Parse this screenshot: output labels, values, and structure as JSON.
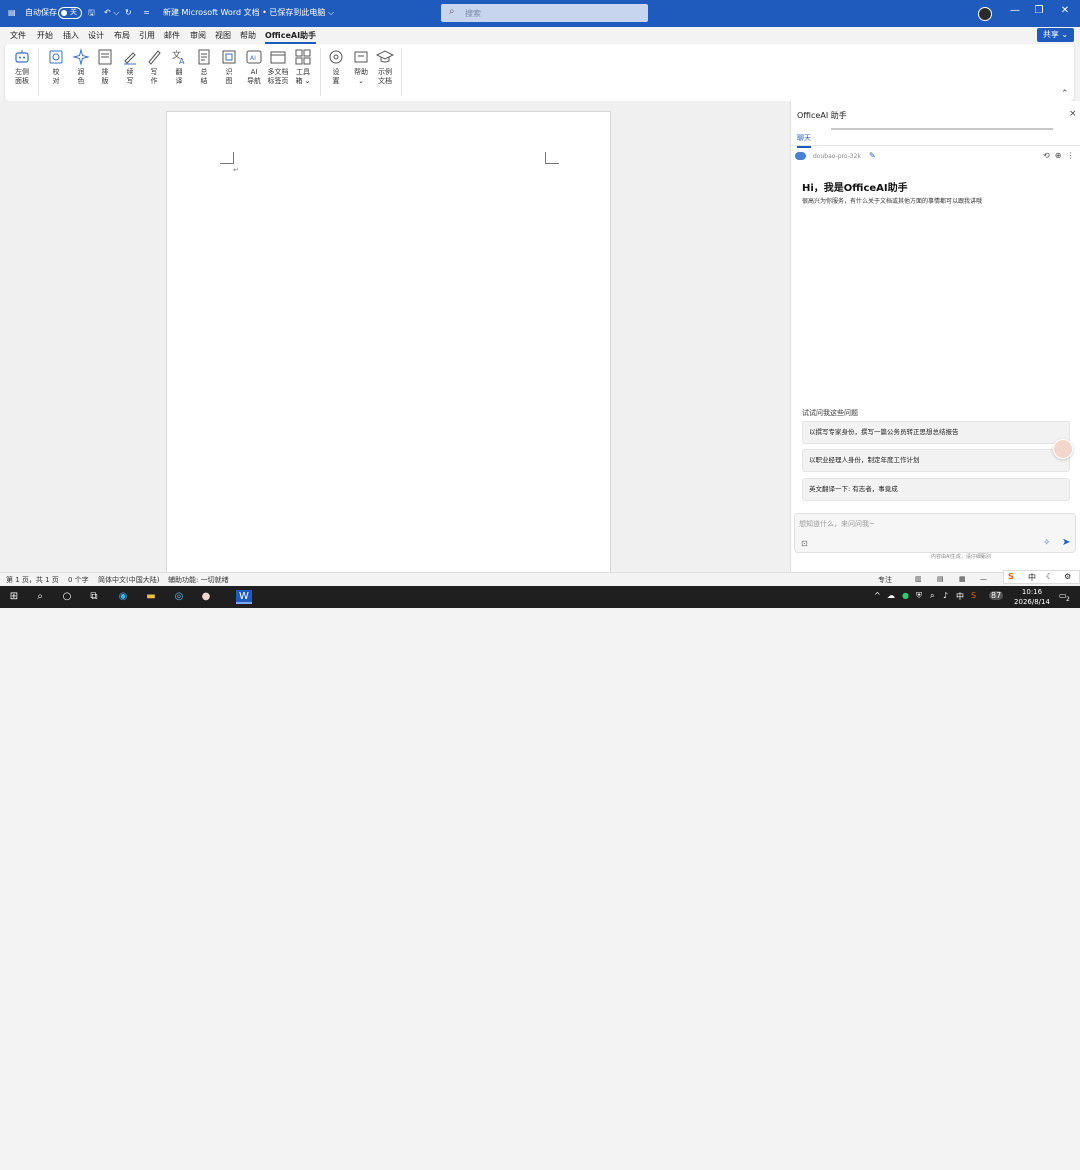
{
  "titlebar": {
    "autosave_label": "自动保存",
    "autosave_state": "关",
    "doc_title": "新建 Microsoft Word 文档 • 已保存到此电脑 ⌵",
    "search_placeholder": "搜索",
    "minimize": "—",
    "restore": "❐",
    "close": "✕"
  },
  "menu": {
    "items": [
      "文件",
      "开始",
      "插入",
      "设计",
      "布局",
      "引用",
      "邮件",
      "审阅",
      "视图",
      "帮助",
      "OfficeAI助手"
    ],
    "share_label": "共享 ⌄"
  },
  "ribbon": {
    "buttons": [
      {
        "label": "左侧\n面板",
        "icon": "robot-icon"
      },
      {
        "label": "校\n对",
        "icon": "proofread-icon"
      },
      {
        "label": "润\n色",
        "icon": "sparkle-icon"
      },
      {
        "label": "排\n版",
        "icon": "layout-icon"
      },
      {
        "label": "续\n写",
        "icon": "continue-write-icon"
      },
      {
        "label": "写\n作",
        "icon": "pen-icon"
      },
      {
        "label": "翻\n译",
        "icon": "translate-icon"
      },
      {
        "label": "总\n结",
        "icon": "summary-icon"
      },
      {
        "label": "识\n图",
        "icon": "image-recognize-icon"
      },
      {
        "label": "AI\n导航",
        "icon": "ai-nav-icon"
      },
      {
        "label": "多文档\n标签页",
        "icon": "tabs-icon"
      },
      {
        "label": "工具\n箱 ⌄",
        "icon": "toolbox-icon"
      },
      {
        "label": "设\n置",
        "icon": "gear-icon"
      },
      {
        "label": "帮助\n⌄",
        "icon": "help-icon"
      },
      {
        "label": "示例\n文档",
        "icon": "hat-icon"
      }
    ]
  },
  "pane": {
    "title": "OfficeAI 助手",
    "close": "×",
    "tab": "聊天",
    "model": "doubao-pro-32k",
    "greeting_title": "Hi，我是OfficeAI助手",
    "greeting_sub": "很高兴为你服务，有什么关于文档或其他方面的事情都可以跟我讲哦",
    "try_label": "试试问我这些问题",
    "suggestions": [
      "以撰写专家身份，撰写一篇公务员转正思想总结报告",
      "以职业经理人身份，制定年度工作计划",
      "英文翻译一下: 有志者，事竟成"
    ],
    "input_placeholder": "想知道什么，来问问我~",
    "disclaimer": "内容由AI生成，请仔细甄别"
  },
  "statusbar": {
    "page": "第 1 页，共 1 页",
    "words": "0 个字",
    "lang": "简体中文(中国大陆)",
    "accessibility": "辅助功能: 一切就绪",
    "focus": "专注",
    "zoom_minus": "—",
    "zoom_plus": "+"
  },
  "taskbar": {
    "ime": "中",
    "time": "10:16",
    "date": "2026/8/14",
    "tray_ime": "中",
    "battery": "87",
    "notif": "2"
  }
}
